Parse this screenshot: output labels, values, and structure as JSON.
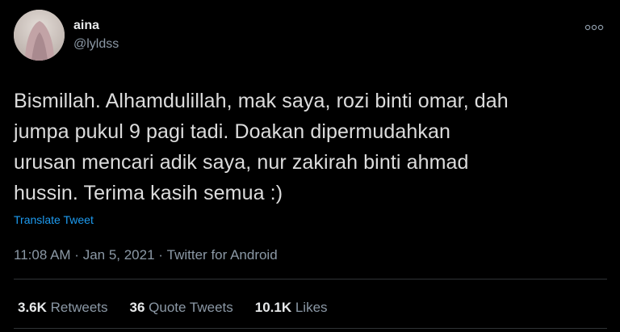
{
  "author": {
    "name": "aina",
    "handle": "@lyldss"
  },
  "menu": {
    "more_icon": "more-options-icon"
  },
  "tweet": {
    "lines": [
      "Bismillah. Alhamdulillah, mak saya, rozi binti omar, dah",
      "jumpa pukul 9 pagi tadi. Doakan dipermudahkan",
      "urusan mencari adik saya, nur zakirah binti ahmad",
      "hussin. Terima kasih semua :)"
    ],
    "translate_label": "Translate Tweet"
  },
  "meta": {
    "time": "11:08 AM",
    "separator1": " · ",
    "date": "Jan 5, 2021",
    "separator2": " · ",
    "source": "Twitter for Android"
  },
  "stats": {
    "retweets": {
      "count": "3.6K",
      "label": " Retweets"
    },
    "quotes": {
      "count": "36",
      "label": " Quote Tweets"
    },
    "likes": {
      "count": "10.1K",
      "label": " Likes"
    }
  },
  "colors": {
    "background": "#000000",
    "text": "#dcdcdc",
    "muted": "#8b98a5",
    "link": "#1d9bf0",
    "divider": "#2f3336"
  }
}
